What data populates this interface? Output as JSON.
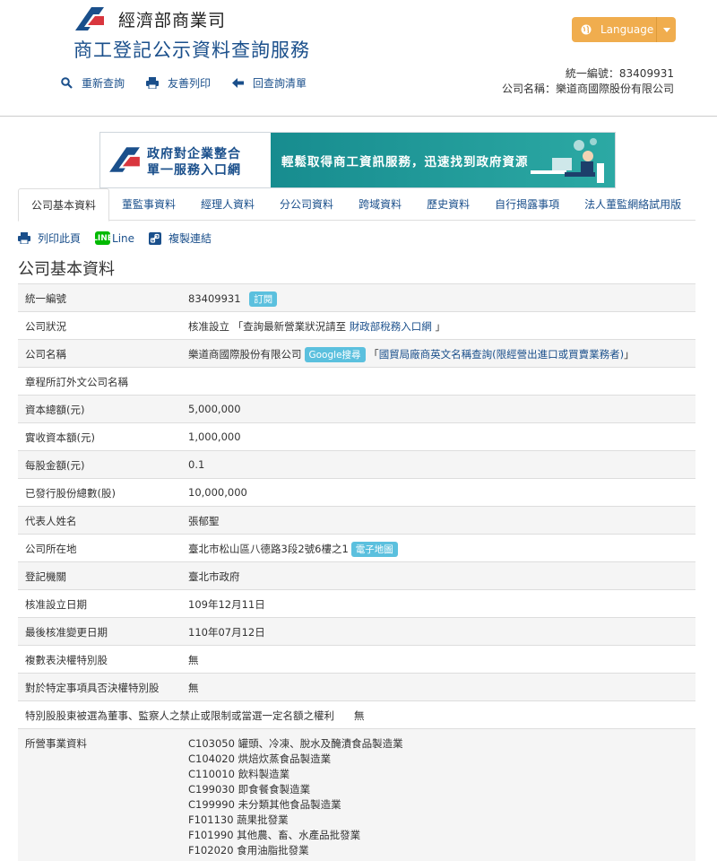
{
  "header": {
    "org_name": "經濟部商業司",
    "service_title": "商工登記公示資料查詢服務",
    "actions": [
      {
        "label": "重新查詢",
        "icon": "search-icon"
      },
      {
        "label": "友善列印",
        "icon": "print-icon"
      },
      {
        "label": "回查詢清單",
        "icon": "arrow-left-icon"
      }
    ],
    "language_label": "Language",
    "company_id_line": "統一編號：83409931",
    "company_name_line": "公司名稱：樂道商國際股份有限公司"
  },
  "banner": {
    "title_line1": "政府對企業整合",
    "title_line2": "單一服務入口網",
    "slogan": "輕鬆取得商工資訊服務，迅速找到政府資源"
  },
  "tabs": [
    {
      "label": "公司基本資料",
      "active": true
    },
    {
      "label": "董監事資料",
      "active": false
    },
    {
      "label": "經理人資料",
      "active": false
    },
    {
      "label": "分公司資料",
      "active": false
    },
    {
      "label": "跨域資料",
      "active": false
    },
    {
      "label": "歷史資料",
      "active": false
    },
    {
      "label": "自行揭露事項",
      "active": false
    },
    {
      "label": "法人董監網絡試用版",
      "active": false
    }
  ],
  "tools": {
    "print_label": "列印此頁",
    "line_badge": "LINE",
    "line_label": "Line",
    "copy_label": "複製連結"
  },
  "section_title": "公司基本資料",
  "info": {
    "tax_id": {
      "label": "統一編號",
      "value": "83409931",
      "badge": "訂閱"
    },
    "status": {
      "label": "公司狀況",
      "value_prefix": "核准設立 「查詢最新營業狀況請至 ",
      "link": "財政部稅務入口網",
      "value_suffix": " 」"
    },
    "company_name": {
      "label": "公司名稱",
      "value": "樂道商國際股份有限公司",
      "badge": "Google搜尋",
      "bracket_open": " 「",
      "link": "國貿局廠商英文名稱查詢(限經營出進口或買賣業務者)",
      "bracket_close": "」"
    },
    "foreign_name": {
      "label": "章程所訂外文公司名稱",
      "value": ""
    },
    "capital_total": {
      "label": "資本總額(元)",
      "value": "5,000,000"
    },
    "paid_capital": {
      "label": "實收資本額(元)",
      "value": "1,000,000"
    },
    "par_value": {
      "label": "每股金額(元)",
      "value": "0.1"
    },
    "shares_issued": {
      "label": "已發行股份總數(股)",
      "value": "10,000,000"
    },
    "representative": {
      "label": "代表人姓名",
      "value": "張郁聖"
    },
    "address": {
      "label": "公司所在地",
      "value": "臺北市松山區八德路3段2號6樓之1",
      "badge": "電子地圖"
    },
    "registry": {
      "label": "登記機關",
      "value": "臺北市政府"
    },
    "approval_date": {
      "label": "核准設立日期",
      "value": "109年12月11日"
    },
    "last_change_date": {
      "label": "最後核准變更日期",
      "value": "110年07月12日"
    },
    "multi_vote": {
      "label": "複數表決權特別股",
      "value": "無"
    },
    "veto_right": {
      "label": "對於特定事項具否決權特別股",
      "value": "無"
    },
    "special_shares": {
      "label": "特別股股東被選為董事、監察人之禁止或限制或當選一定名額之權利",
      "value": "無"
    },
    "business": {
      "label": "所營事業資料",
      "items": [
        "C103050  罐頭、冷凍、脫水及醃漬食品製造業",
        "C104020  烘焙炊蒸食品製造業",
        "C110010  飲料製造業",
        "C199030  即食餐食製造業",
        "C199990  未分類其他食品製造業",
        "F101130  蔬果批發業",
        "F101990  其他農、畜、水產品批發業",
        "F102020  食用油脂批發業"
      ]
    }
  }
}
